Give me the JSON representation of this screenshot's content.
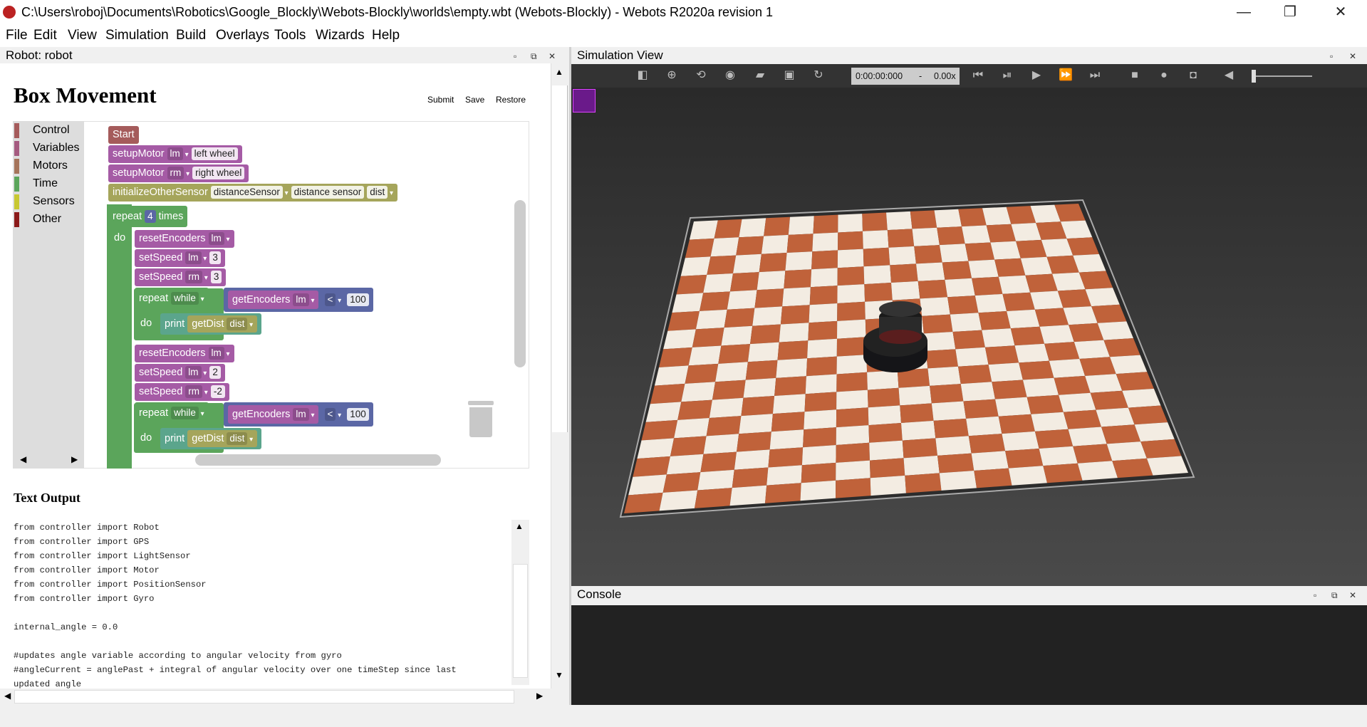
{
  "window": {
    "title": "C:\\Users\\roboj\\Documents\\Robotics\\Google_Blockly\\Webots-Blockly\\worlds\\empty.wbt (Webots-Blockly) - Webots R2020a revision 1",
    "minimize": "—",
    "restore": "❐",
    "close": "✕"
  },
  "menu": [
    "File",
    "Edit",
    "View",
    "Simulation",
    "Build",
    "Overlays",
    "Tools",
    "Wizards",
    "Help"
  ],
  "robot_panel": {
    "title": "Robot: robot",
    "heading": "Box Movement",
    "buttons": {
      "submit": "Submit",
      "save": "Save",
      "restore": "Restore"
    },
    "toolbox": [
      {
        "label": "Control",
        "color": "#a55b5b"
      },
      {
        "label": "Variables",
        "color": "#a55b80"
      },
      {
        "label": "Motors",
        "color": "#a5745b"
      },
      {
        "label": "Time",
        "color": "#5ba55b"
      },
      {
        "label": "Sensors",
        "color": "#c8c832"
      },
      {
        "label": "Other",
        "color": "#8b1a1a"
      }
    ],
    "blocks": {
      "start": "Start",
      "setupMotor": "setupMotor",
      "lm": "lm",
      "rm": "rm",
      "left_wheel": "left wheel",
      "right_wheel": "right wheel",
      "initializeOtherSensor": "initializeOtherSensor",
      "distanceSensor": "distanceSensor",
      "distance_sensor": "distance sensor",
      "dist": "dist",
      "repeat": "repeat",
      "times_count": "4",
      "times": "times",
      "do": "do",
      "resetEncoders": "resetEncoders",
      "setSpeed": "setSpeed",
      "speed1": "3",
      "speed2": "2",
      "speed3": "-2",
      "while": "while",
      "getEncoders": "getEncoders",
      "lt": "<",
      "hundred": "100",
      "print": "print",
      "getDist": "getDist"
    },
    "text_output_heading": "Text Output",
    "code_lines": "from controller import Robot\nfrom controller import GPS\nfrom controller import LightSensor\nfrom controller import Motor\nfrom controller import PositionSensor\nfrom controller import Gyro\n\ninternal_angle = 0.0\n\n#updates angle variable according to angular velocity from gyro\n#angleCurrent = anglePast + integral of angular velocity over one timeStep since last\nupdated angle"
  },
  "simulation": {
    "title": "Simulation View",
    "time": "0:00:00:000",
    "dash": "-",
    "speed": "0.00x"
  },
  "console": {
    "title": "Console"
  },
  "colors": {
    "floor_dark": "#c0623a",
    "floor_light": "#f3ece2",
    "bg_dark": "#2e2e2e"
  }
}
